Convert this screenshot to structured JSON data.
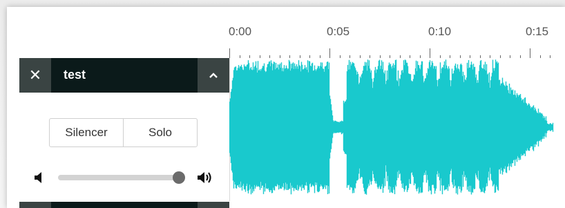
{
  "colors": {
    "waveform": "#19c9cd",
    "header_bg": "#0b1a1a",
    "header_button_bg": "#3a4443"
  },
  "timeline": {
    "labels": [
      "0:00",
      "0:05",
      "0:10",
      "0:15"
    ]
  },
  "track": {
    "name": "test",
    "close_icon": "close-icon",
    "collapse_icon": "chevron-up-icon",
    "mute_label": "Silencer",
    "solo_label": "Solo",
    "volume": 0.97,
    "volume_low_icon": "speaker-low-icon",
    "volume_high_icon": "speaker-high-icon"
  }
}
